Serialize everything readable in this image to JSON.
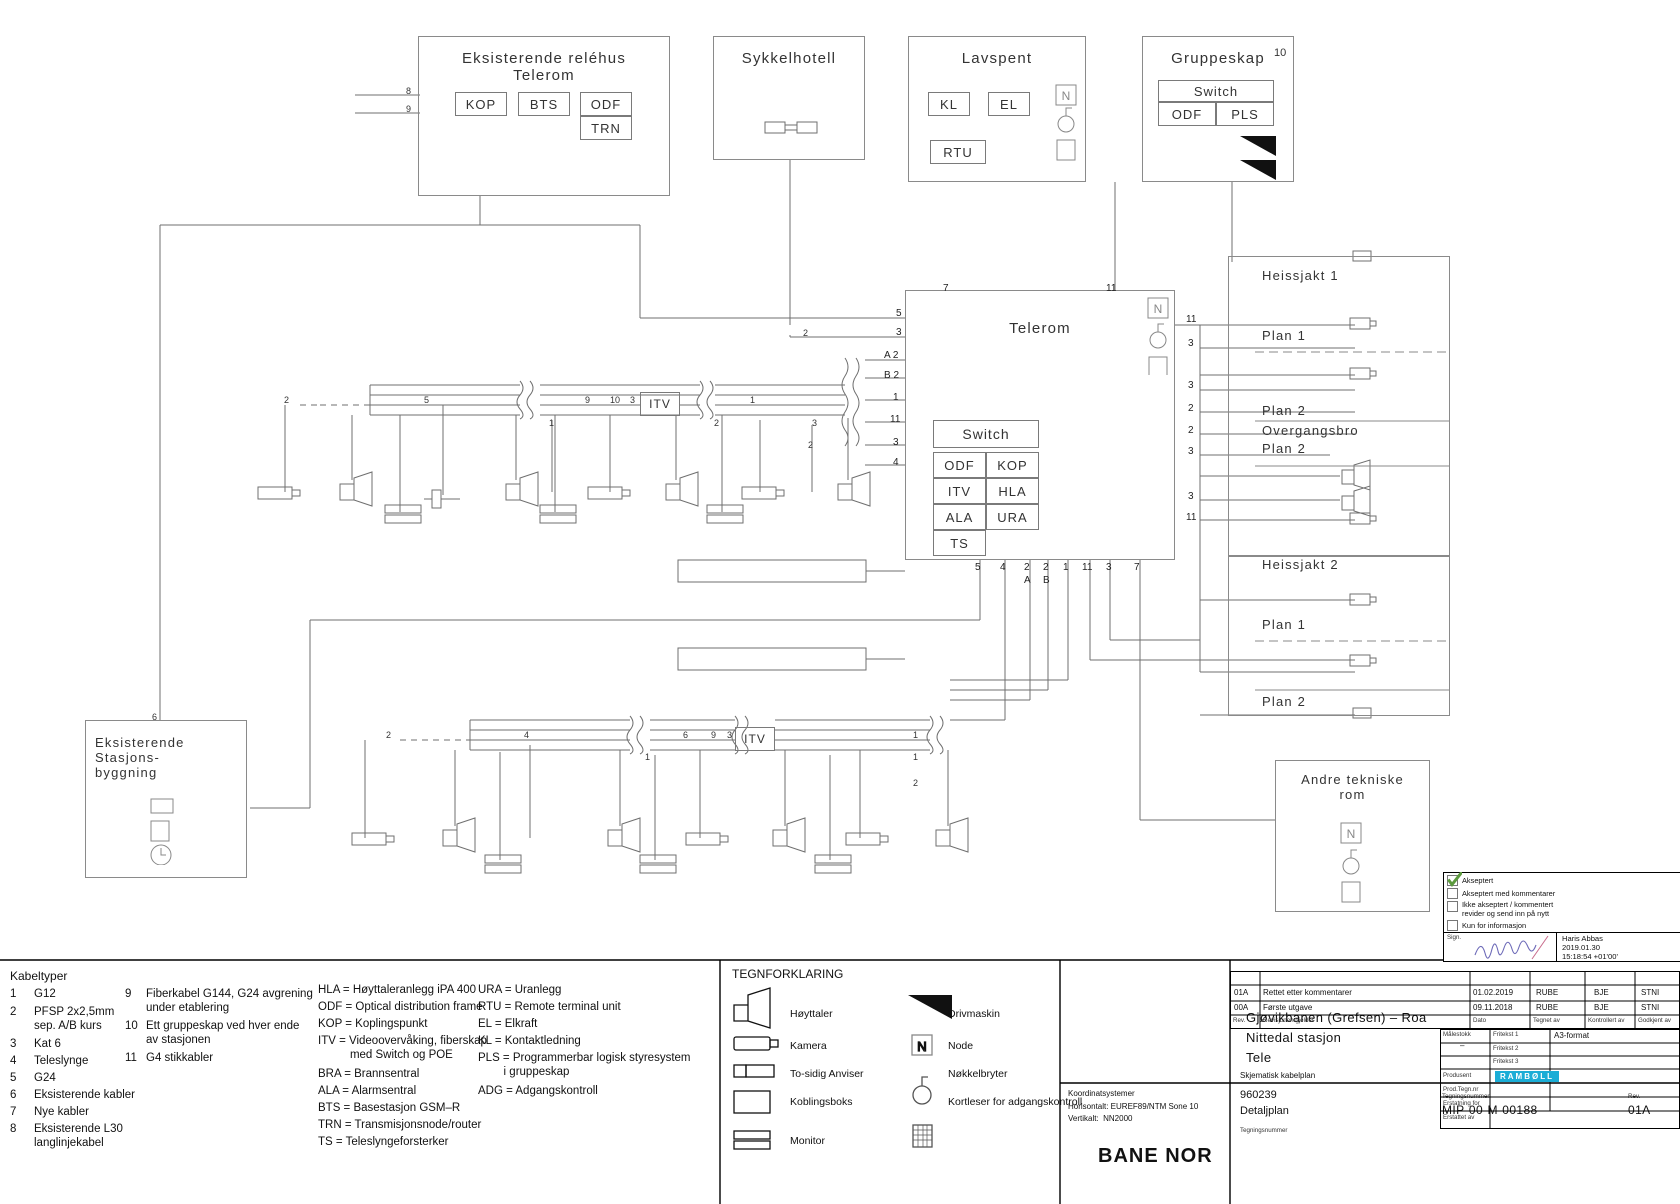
{
  "drawing": {
    "title_lines": [
      "Gjøvikbanen (Grefsen) – Roa",
      "Nittedal stasjon",
      "Tele"
    ],
    "subtitle": "Skjematisk kabelplan",
    "project_number": "960239",
    "plan_type": "Detaljplan",
    "drawing_number": "MIP-00-M-00188",
    "revision": "01A",
    "format": "A3-format",
    "scale_label": "Målestokk",
    "scale_value": "–",
    "coordinate_heading": "Koordinatsystemer",
    "coordinate_lines": [
      "Horisontalt: EUREF89/NTM Sone 10",
      "Vertikalt:  NN2000"
    ],
    "company": "BANE NOR",
    "producer_label": "Produsent",
    "producer": "RAMBØLL",
    "free_text_labels": [
      "Fritekst 1",
      "Fritekst 2",
      "Fritekst 3"
    ],
    "prod_no_label": "Prod.Tegn.nr",
    "erstatning_for": "Erstatning for",
    "erstattet_av": "Erstattet av",
    "tegningsnummer_label": "Tegningsnummer",
    "rev_label": "Rev.",
    "drawing_no_label": "Tegningsnummer"
  },
  "revision_table": {
    "headers": [
      "Rev.",
      "Revisjonen gjelder",
      "Dato",
      "Tegnet av",
      "Kontrollert av",
      "Godkjent av"
    ],
    "rows": [
      {
        "rev": "01A",
        "desc": "Rettet etter kommentarer",
        "date": "01.02.2019",
        "drawn": "RUBE",
        "checked": "BJE",
        "approved": "STNI"
      },
      {
        "rev": "00A",
        "desc": "Første utgave",
        "date": "09.11.2018",
        "drawn": "RUBE",
        "checked": "BJE",
        "approved": "STNI"
      }
    ]
  },
  "stamp": {
    "options": [
      {
        "label": "Akseptert",
        "checked": true
      },
      {
        "label": "Akseptert med kommentarer",
        "checked": false
      },
      {
        "label": "Ikke akseptert / kommentert\nrevider og send inn på nytt",
        "checked": false
      },
      {
        "label": "Kun for informasjon",
        "checked": false
      }
    ],
    "sign_label": "Sign.",
    "signer": "Haris Abbas",
    "sign_date": "2019.01.30",
    "sign_time": "15:18:54 +01'00'"
  },
  "cable_types": {
    "heading": "Kabeltyper",
    "col1": [
      {
        "no": "1",
        "text": "G12"
      },
      {
        "no": "2",
        "text": "PFSP 2x2,5mm\nsep. A/B kurs"
      },
      {
        "no": "3",
        "text": "Kat 6"
      },
      {
        "no": "4",
        "text": "Teleslynge"
      },
      {
        "no": "5",
        "text": "G24"
      },
      {
        "no": "6",
        "text": "Eksisterende kabler"
      },
      {
        "no": "7",
        "text": "Nye kabler"
      },
      {
        "no": "8",
        "text": "Eksisterende L30\nlanglinjekabel"
      }
    ],
    "col2": [
      {
        "no": "9",
        "text": "Fiberkabel G144, G24 avgrening\nunder etablering"
      },
      {
        "no": "10",
        "text": "Ett gruppeskap ved hver ende\nav stasjonen"
      },
      {
        "no": "11",
        "text": "G4 stikkabler"
      }
    ]
  },
  "abbreviations": {
    "col1": [
      "HLA = Høyttaleranlegg iPA 400",
      "ODF = Optical distribution frame",
      "KOP = Koplingspunkt",
      "ITV = Videoovervåking, fiberskap\n          med Switch og POE",
      "BRA = Brannsentral",
      "ALA = Alarmsentral",
      "BTS = Basestasjon GSM–R",
      "TRN = Transmisjonsnode/router",
      "TS = Teleslyngeforsterker"
    ],
    "col2": [
      "URA = Uranlegg",
      "RTU = Remote terminal unit",
      "EL = Elkraft",
      "KL = Kontaktledning",
      "PLS = Programmerbar logisk styresystem\n        i gruppeskap",
      "ADG = Adgangskontroll"
    ]
  },
  "symbol_legend": {
    "heading": "TEGNFORKLARING",
    "col1": [
      {
        "icon": "loudspeaker-icon",
        "label": "Høyttaler"
      },
      {
        "icon": "camera-icon",
        "label": "Kamera"
      },
      {
        "icon": "two-sided-display-icon",
        "label": "To-sidig Anviser"
      },
      {
        "icon": "junction-box-icon",
        "label": "Koblingsboks"
      },
      {
        "icon": "monitor-icon",
        "label": "Monitor"
      }
    ],
    "col2": [
      {
        "icon": "drive-machine-icon",
        "label": "Drivmaskin"
      },
      {
        "icon": "node-icon",
        "label": "Node"
      },
      {
        "icon": "key-switch-icon",
        "label": "Nøkkelbryter"
      },
      {
        "icon": "card-reader-icon",
        "label": "Kortleser for adgangskontroll"
      }
    ]
  },
  "diagram": {
    "rooms": [
      {
        "id": "relehus",
        "title": "Eksisterende reléhus\nTelerom",
        "modules": [
          "KOP",
          "BTS",
          "ODF",
          "TRN"
        ]
      },
      {
        "id": "sykkelhotell",
        "title": "Sykkelhotell",
        "modules": []
      },
      {
        "id": "lavspent",
        "title": "Lavspent",
        "modules": [
          "KL",
          "EL",
          "RTU"
        ]
      },
      {
        "id": "gruppeskap",
        "title": "Gruppeskap",
        "badge": "10",
        "modules": [
          "Switch",
          "ODF",
          "PLS"
        ]
      },
      {
        "id": "telerom",
        "title": "Telerom",
        "modules": [
          "Switch",
          "ODF",
          "KOP",
          "ITV",
          "HLA",
          "ALA",
          "URA",
          "TS"
        ]
      },
      {
        "id": "stasjonsbygning",
        "title": "Eksisterende\nStasjons-\nbygning",
        "badge": "6"
      },
      {
        "id": "andre-tekniske-rom",
        "title": "Andre tekniske\nrom"
      }
    ],
    "platform_rooms": [
      {
        "id": "heissjakt-1",
        "title": "Heissjakt 1"
      },
      {
        "id": "plan-1-a",
        "title": "Plan 1"
      },
      {
        "id": "plan-2-a",
        "title": "Plan 2"
      },
      {
        "id": "overgangsbro",
        "title": "Overgangsbro"
      },
      {
        "id": "plan-2-b",
        "title": "Plan 2"
      },
      {
        "id": "heissjakt-2",
        "title": "Heissjakt 2"
      },
      {
        "id": "plan-1-b",
        "title": "Plan 1"
      },
      {
        "id": "plan-2-c",
        "title": "Plan 2"
      }
    ],
    "itv_label": "ITV",
    "cable_marks_top_left": [
      "8",
      "9"
    ],
    "telerom_left_marks": [
      "5",
      "3",
      "A 2",
      "B 2",
      "1",
      "11",
      "3",
      "4"
    ],
    "telerom_top_marks": [
      "7",
      "11"
    ],
    "telerom_bottom_marks": [
      "5",
      "4",
      "2\nA",
      "2\nB",
      "1",
      "11",
      "3",
      "7"
    ],
    "right_marks": [
      "11",
      "3",
      "3",
      "2",
      "2",
      "3",
      "3",
      "11"
    ],
    "upper_run_marks": [
      "2",
      "5",
      "9",
      "10",
      "3",
      "1",
      "1",
      "1",
      "2",
      "3",
      "2"
    ],
    "lower_run_marks": [
      "2",
      "1",
      "4",
      "6",
      "9",
      "3",
      "1",
      "1",
      "2"
    ]
  }
}
